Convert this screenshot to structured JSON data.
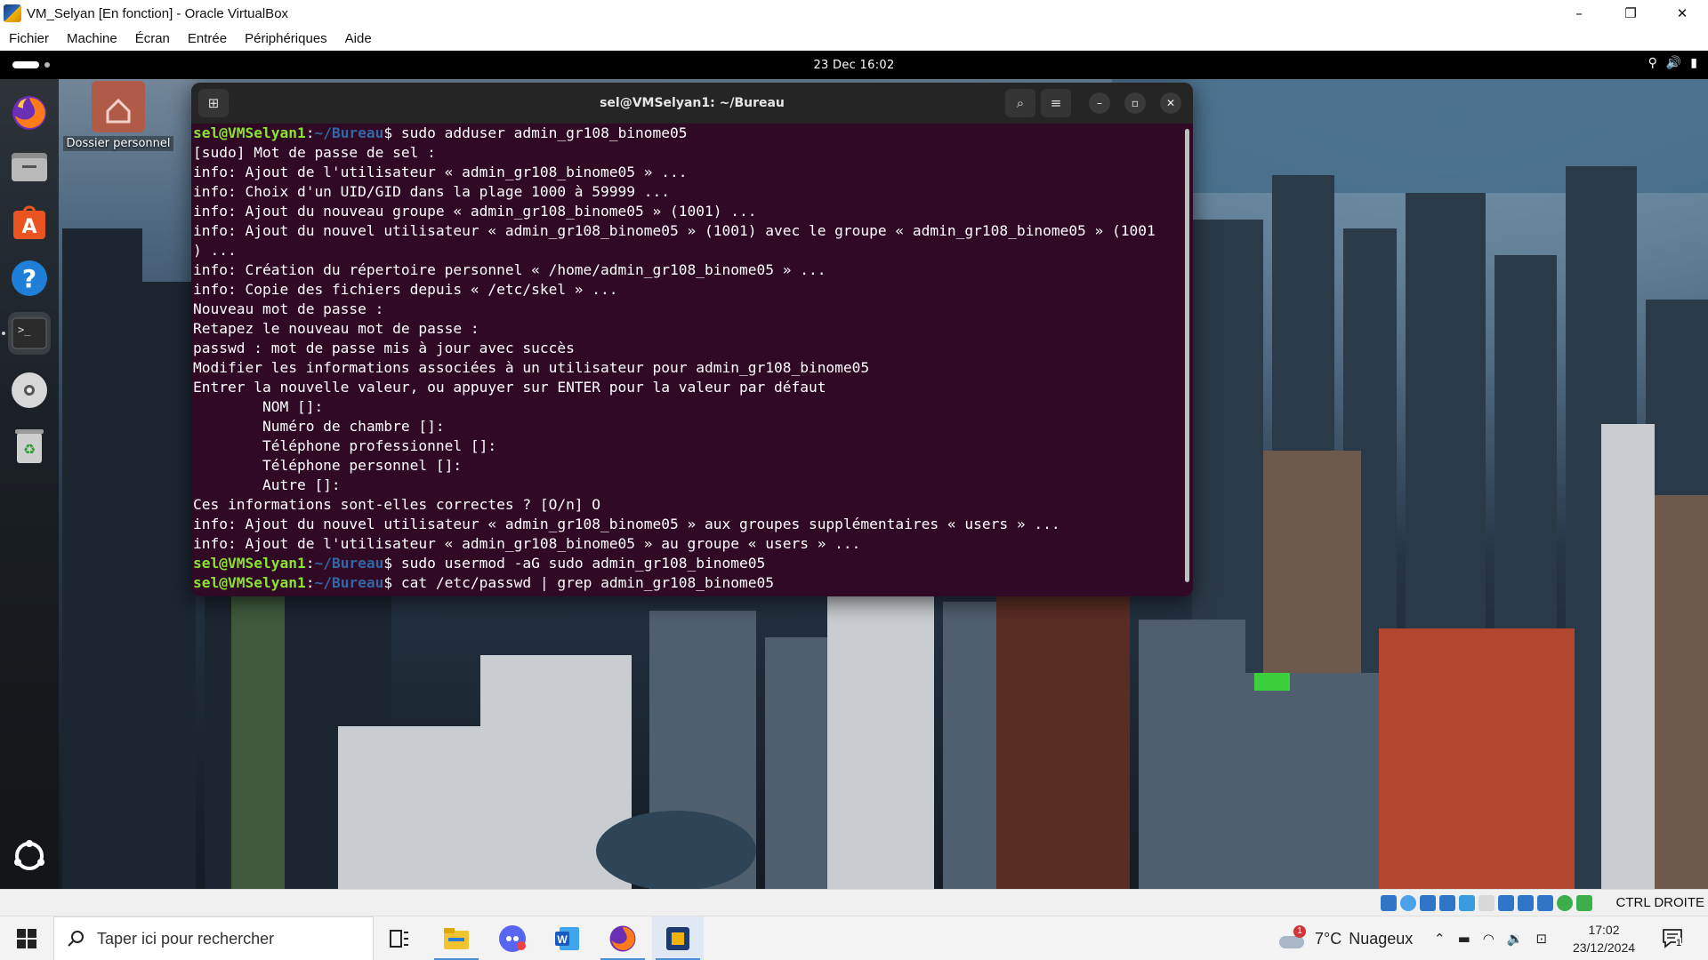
{
  "host_window": {
    "title": "VM_Selyan [En fonction] - Oracle VirtualBox",
    "controls": {
      "minimize": "–",
      "restore": "❐",
      "close": "✕"
    }
  },
  "vb_menu": [
    "Fichier",
    "Machine",
    "Écran",
    "Entrée",
    "Périphériques",
    "Aide"
  ],
  "gnome": {
    "clock": "23 Dec  16:02",
    "dock_items": [
      "firefox-icon",
      "files-icon",
      "app-center-icon",
      "help-icon",
      "terminal-icon",
      "optical-disc-icon",
      "trash-icon",
      "show-apps-icon"
    ],
    "desktop_icon_label": "Dossier personnel"
  },
  "terminal": {
    "title": "sel@VMSelyan1: ~/Bureau",
    "prompt_user": "sel@VMSelyan1",
    "prompt_path": "~/Bureau",
    "lines": [
      {
        "type": "prompt",
        "cmd": "sudo adduser admin_gr108_binome05"
      },
      {
        "type": "out",
        "text": "[sudo] Mot de passe de sel :"
      },
      {
        "type": "out",
        "text": "info: Ajout de l'utilisateur « admin_gr108_binome05 » ..."
      },
      {
        "type": "out",
        "text": "info: Choix d'un UID/GID dans la plage 1000 à 59999 ..."
      },
      {
        "type": "out",
        "text": "info: Ajout du nouveau groupe « admin_gr108_binome05 » (1001) ..."
      },
      {
        "type": "out",
        "text": "info: Ajout du nouvel utilisateur « admin_gr108_binome05 » (1001) avec le groupe « admin_gr108_binome05 » (1001"
      },
      {
        "type": "out",
        "text": ") ..."
      },
      {
        "type": "out",
        "text": "info: Création du répertoire personnel « /home/admin_gr108_binome05 » ..."
      },
      {
        "type": "out",
        "text": "info: Copie des fichiers depuis « /etc/skel » ..."
      },
      {
        "type": "out",
        "text": "Nouveau mot de passe :"
      },
      {
        "type": "out",
        "text": "Retapez le nouveau mot de passe :"
      },
      {
        "type": "out",
        "text": "passwd : mot de passe mis à jour avec succès"
      },
      {
        "type": "out",
        "text": "Modifier les informations associées à un utilisateur pour admin_gr108_binome05"
      },
      {
        "type": "out",
        "text": "Entrer la nouvelle valeur, ou appuyer sur ENTER pour la valeur par défaut"
      },
      {
        "type": "out",
        "text": "        NOM []:"
      },
      {
        "type": "out",
        "text": "        Numéro de chambre []:"
      },
      {
        "type": "out",
        "text": "        Téléphone professionnel []:"
      },
      {
        "type": "out",
        "text": "        Téléphone personnel []:"
      },
      {
        "type": "out",
        "text": "        Autre []:"
      },
      {
        "type": "out",
        "text": "Ces informations sont-elles correctes ? [O/n] O"
      },
      {
        "type": "out",
        "text": "info: Ajout du nouvel utilisateur « admin_gr108_binome05 » aux groupes supplémentaires « users » ..."
      },
      {
        "type": "out",
        "text": "info: Ajout de l'utilisateur « admin_gr108_binome05 » au groupe « users » ..."
      },
      {
        "type": "prompt",
        "cmd": "sudo usermod -aG sudo admin_gr108_binome05"
      },
      {
        "type": "prompt",
        "cmd": "cat /etc/passwd | grep admin_gr108_binome05"
      }
    ]
  },
  "vb_status": {
    "host_key": "CTRL DROITE"
  },
  "taskbar": {
    "search_placeholder": "Taper ici pour rechercher",
    "apps": [
      "task-view-icon",
      "file-explorer-icon",
      "discord-icon",
      "word-icon",
      "firefox-icon",
      "virtualbox-icon"
    ],
    "weather_temp": "7°C",
    "weather_desc": "Nuageux",
    "weather_badge": "1",
    "time": "17:02",
    "date": "23/12/2024",
    "notification_count": "1"
  },
  "colors": {
    "terminal_bg": "#300a24",
    "prompt_user": "#8ae234",
    "prompt_path": "#3465a4",
    "gnome_bar": "#000000"
  }
}
